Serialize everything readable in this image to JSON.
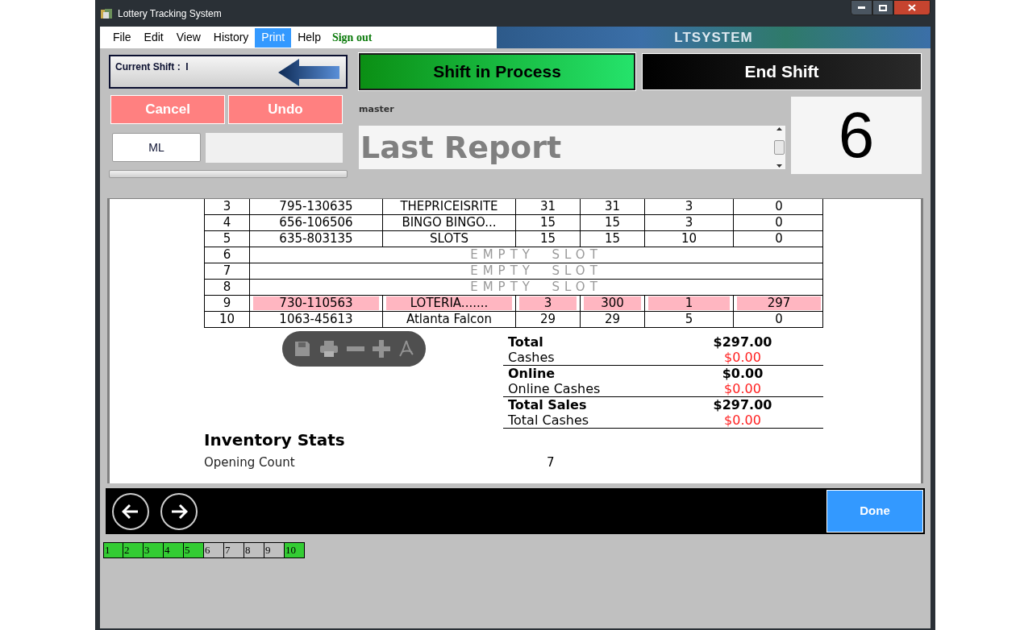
{
  "window": {
    "title": "Lottery Tracking System"
  },
  "menu": [
    {
      "label": "File",
      "selected": false
    },
    {
      "label": "Edit",
      "selected": false
    },
    {
      "label": "View",
      "selected": false
    },
    {
      "label": "History",
      "selected": false
    },
    {
      "label": "Print",
      "selected": true
    },
    {
      "label": "Help",
      "selected": false
    }
  ],
  "sign_out": "Sign out",
  "banner": "LTSYSTEM",
  "current_shift": "Current Shift :  I",
  "actions": [
    "Cancel",
    "Undo"
  ],
  "ml_button": "ML",
  "shift_status": "Shift in Process",
  "end_shift": "End Shift",
  "user": "master",
  "report_field": {
    "value": "Last Report"
  },
  "counter": "6",
  "report": {
    "rows": [
      {
        "kind": "game",
        "highlight": false,
        "cells": [
          "3",
          "795-130635",
          "THEPRICEISRITE",
          "31",
          "31",
          "3",
          "0"
        ]
      },
      {
        "kind": "game",
        "highlight": false,
        "cells": [
          "4",
          "656-106506",
          "BINGO BINGO...",
          "15",
          "15",
          "3",
          "0"
        ]
      },
      {
        "kind": "game",
        "highlight": false,
        "cells": [
          "5",
          "635-803135",
          "SLOTS",
          "15",
          "15",
          "10",
          "0"
        ]
      },
      {
        "kind": "empty",
        "cells": [
          "6",
          "EMPTY  SLOT"
        ]
      },
      {
        "kind": "empty",
        "cells": [
          "7",
          "EMPTY  SLOT"
        ]
      },
      {
        "kind": "empty",
        "cells": [
          "8",
          "EMPTY  SLOT"
        ]
      },
      {
        "kind": "game",
        "highlight": true,
        "cells": [
          "9",
          "730-110563",
          "LOTERIA.......",
          "3",
          "300",
          "1",
          "297"
        ]
      },
      {
        "kind": "game",
        "highlight": false,
        "cells": [
          "10",
          "1063-45613",
          "Atlanta Falcon",
          "29",
          "29",
          "5",
          "0"
        ]
      }
    ],
    "totals": [
      {
        "kind": "total",
        "label": "Total",
        "value": "$297.00"
      },
      {
        "kind": "cashes",
        "label": "Cashes",
        "value": "$0.00"
      },
      {
        "kind": "total",
        "label": "Online",
        "value": "$0.00"
      },
      {
        "kind": "cashes",
        "label": "Online Cashes",
        "value": "$0.00"
      },
      {
        "kind": "total",
        "label": "Total Sales",
        "value": "$297.00"
      },
      {
        "kind": "cashes",
        "label": "Total Cashes",
        "value": "$0.00"
      }
    ],
    "section_title": "Inventory Stats",
    "stats": [
      {
        "label": "Opening Count",
        "value": "7"
      }
    ]
  },
  "done_button": "Done",
  "pages": [
    {
      "label": "1",
      "done": true
    },
    {
      "label": "2",
      "done": true
    },
    {
      "label": "3",
      "done": true
    },
    {
      "label": "4",
      "done": true
    },
    {
      "label": "5",
      "done": true
    },
    {
      "label": "6",
      "done": false
    },
    {
      "label": "7",
      "done": false
    },
    {
      "label": "8",
      "done": false
    },
    {
      "label": "9",
      "done": false
    },
    {
      "label": "10",
      "done": true
    }
  ]
}
